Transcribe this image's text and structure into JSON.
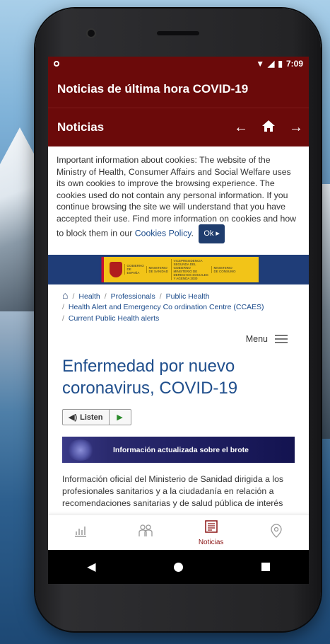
{
  "colors": {
    "brand": "#6b0a0a",
    "link": "#1a4a8a",
    "title": "#1f4e8c"
  },
  "status": {
    "time": "7:09"
  },
  "app": {
    "title": "Noticias de última hora COVID-19"
  },
  "nav": {
    "section": "Noticias",
    "back_icon": "arrow-left-icon",
    "home_icon": "home-icon",
    "forward_icon": "arrow-right-icon"
  },
  "cookie": {
    "text": "Important information about cookies: The website of the Ministry of Health, Consumer Affairs and Social Welfare uses its own cookies to improve the browsing experience. The cookies used do not contain any personal information. If you continue browsing the site we will understand that you have accepted their use. Find more information on cookies and how to block them in our ",
    "link": "Cookies Policy",
    "after": ".",
    "ok": "Ok"
  },
  "gov": {
    "col1": "GOBIERNO DE ESPAÑA",
    "col2": "MINISTERIO DE SANIDAD",
    "col3": "VICEPRESIDENCIA SEGUNDA DEL GOBIERNO MINISTERIO DE DERECHOS SOCIALES Y AGENDA 2030",
    "col4": "MINISTERIO DE CONSUMO"
  },
  "breadcrumb": {
    "items": [
      "Health",
      "Professionals",
      "Public Health",
      "Health Alert and Emergency Co ordination Centre (CCAES)",
      "Current Public Health alerts"
    ]
  },
  "menu": {
    "label": "Menu"
  },
  "page": {
    "title": "Enfermedad por nuevo coronavirus, COVID-19",
    "listen": "Listen",
    "banner": "Información actualizada sobre el brote",
    "para": "Información oficial del Ministerio de Sanidad dirigida a los profesionales sanitarios y a la ciudadanía en relación a recomendaciones sanitarias y de salud pública de interés"
  },
  "tabs": [
    {
      "label": "",
      "icon": "chart-icon"
    },
    {
      "label": "",
      "icon": "people-icon"
    },
    {
      "label": "Noticias",
      "icon": "newspaper-icon"
    },
    {
      "label": "",
      "icon": "location-icon"
    }
  ]
}
